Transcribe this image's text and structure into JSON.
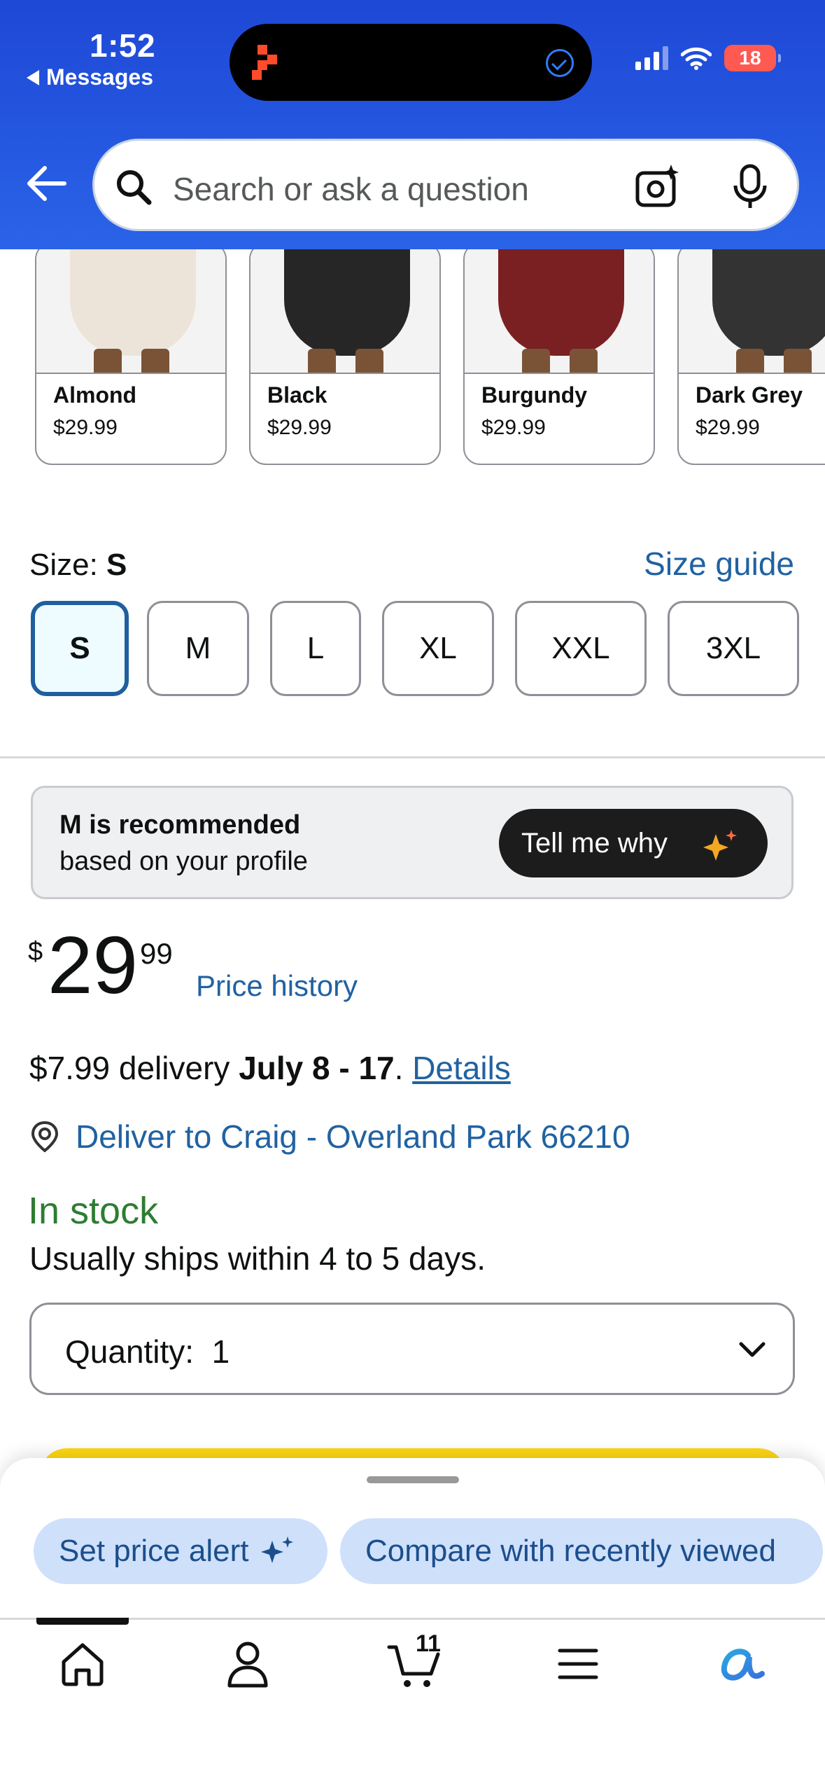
{
  "status_bar": {
    "time": "1:52",
    "back_app": "Messages",
    "battery": "18"
  },
  "header": {
    "search_placeholder": "Search or ask a question"
  },
  "variants": [
    {
      "name": "Almond",
      "price": "$29.99",
      "color": "#ece4d8"
    },
    {
      "name": "Black",
      "price": "$29.99",
      "color": "#262626"
    },
    {
      "name": "Burgundy",
      "price": "$29.99",
      "color": "#7a1f22"
    },
    {
      "name": "Dark Grey",
      "price": "$29.99",
      "color": "#333333"
    }
  ],
  "size": {
    "label": "Size: ",
    "selected": "S",
    "guide_link": "Size guide",
    "options": [
      "S",
      "M",
      "L",
      "XL",
      "XXL",
      "3XL"
    ]
  },
  "recommendation": {
    "title": "M is recommended",
    "subtitle": "based on your profile",
    "button": "Tell me why"
  },
  "price": {
    "currency": "$",
    "whole": "29",
    "fraction": "99",
    "history_link": "Price history"
  },
  "delivery": {
    "cost": "$7.99 delivery ",
    "dates": "July 8 - 17",
    "punct": ". ",
    "details_link": "Details",
    "deliver_to": "Deliver to Craig - Overland Park 66210"
  },
  "stock": {
    "status": "In stock",
    "ships": "Usually ships within 4 to 5 days."
  },
  "quantity": {
    "label": "Quantity:",
    "value": "1"
  },
  "sheet": {
    "chips": [
      "Set price alert",
      "Compare with recently viewed"
    ]
  },
  "tabbar": {
    "cart_count": "11",
    "items": [
      "home-icon",
      "account-icon",
      "cart-icon",
      "menu-icon",
      "rufus-icon"
    ]
  },
  "colors": {
    "header_blue": "#2a5ee6",
    "link_blue": "#2162a1",
    "in_stock_green": "#2e7d32",
    "chip_bg": "#cfe0fb"
  }
}
